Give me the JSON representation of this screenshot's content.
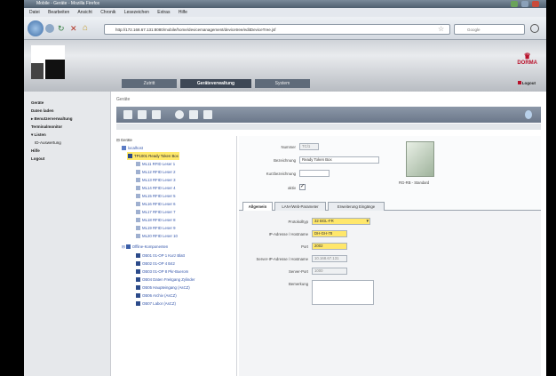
{
  "window": {
    "title": "Mobile - Geräte - Mozilla Firefox"
  },
  "menu": [
    "Datei",
    "Bearbeiten",
    "Ansicht",
    "Chronik",
    "Lesezeichen",
    "Extras",
    "Hilfe"
  ],
  "browser": {
    "url": "http://172.168.67.131:8080/mobile/home/devicemanagement/devicetree/editDeviceTree.jsf",
    "search_placeholder": "Google"
  },
  "app": {
    "top_tabs": [
      "Zutritt",
      "Geräteverwaltung",
      "System"
    ],
    "active_top_tab": 1,
    "brand": "DORMA",
    "logout": "Logout"
  },
  "sidebar": {
    "items": [
      "Geräte",
      "Daten laden",
      "▸ Benutzerverwaltung",
      "Terminalmonitor",
      "▾ Listen",
      "ID-Auswertung",
      "Hilfe",
      "Logout"
    ]
  },
  "content": {
    "section_title": "Geräte"
  },
  "tree": {
    "root": "Geräte",
    "localhost": "localhost",
    "terminal": "TP1001 Ready Token Box",
    "readers": [
      "ML11 RFID Leser 1",
      "ML12 RFID Leser 2",
      "ML13 RFID Leser 3",
      "ML14 RFID Leser 4",
      "ML15 RFID Leser 5",
      "ML16 RFID Leser 6",
      "ML17 RFID Leser 7",
      "ML18 RFID Leser 8",
      "ML19 RFID Leser 9",
      "ML20 RFID Leser 10"
    ],
    "offline_group": "Offline-Komponenten",
    "offline_items": [
      "OB01 01-OP 1 Kurz Blatt",
      "OB02 01-OP 4 B42",
      "OB03 01-OP 8 Pkr-Buerom",
      "OB04 Daten Freitgang Zylinder",
      "OB05 Haupteingang (AsCZ)",
      "OB06 Archiv (AsCZ)",
      "OB07 Labor (AsCZ)"
    ]
  },
  "detail": {
    "nummer_label": "Nummer",
    "nummer": "TC/1",
    "bezeichnung_label": "Bezeichnung",
    "bezeichnung": "Ready Token Box",
    "kurz_label": "Kurzbezeichnung",
    "kurz": "",
    "aktiv_label": "aktiv",
    "device_caption": "RG-RB - Standard",
    "tabs": [
      "Allgemein",
      "LAN-/Web-Parameter",
      "Erweiterung Eingänge"
    ],
    "active_tab": 0,
    "protokoll_label": "Protokolltyp",
    "protokoll": "32 BGL-FR",
    "ip_label": "IP-Adresse / Hostname",
    "ip": "DH-GH-78",
    "port_label": "Port",
    "port": "2002",
    "server_ip_label": "Server-IP-Adresse / Hostname",
    "server_ip": "10.168.67.131",
    "server_port_label": "Server-Port",
    "server_port": "1000",
    "bemerkung_label": "Bemerkung",
    "bemerkung": ""
  },
  "colors": {
    "brand": "#b8102a",
    "selection": "#ffe96b",
    "toolbar": "#7a8698"
  }
}
